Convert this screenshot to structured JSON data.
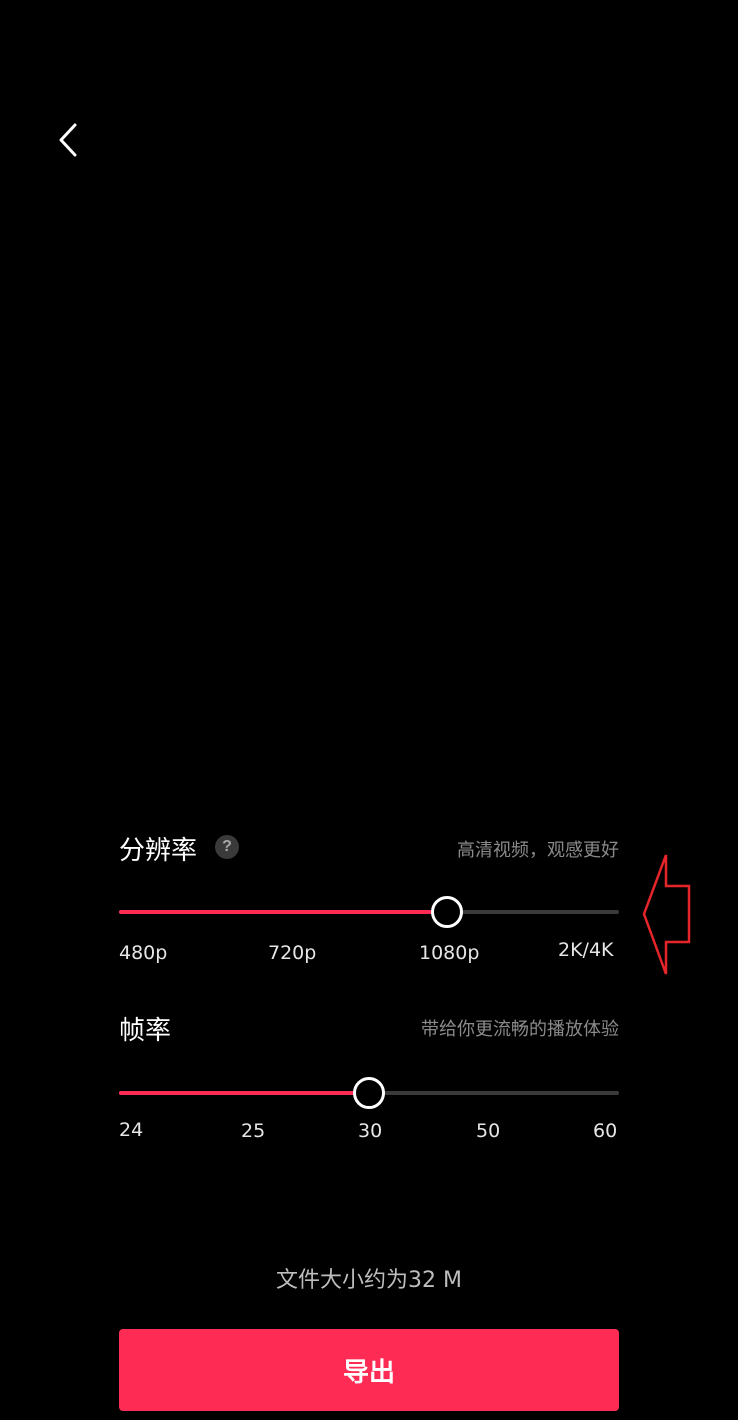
{
  "back": {
    "icon": "chevron-left-icon"
  },
  "resolution": {
    "title": "分辨率",
    "help_icon": "question-icon",
    "help_glyph": "?",
    "hint": "高清视频，观感更好",
    "options": [
      "480p",
      "720p",
      "1080p",
      "2K/4K"
    ],
    "selected": "1080p",
    "selected_index": 2
  },
  "framerate": {
    "title": "帧率",
    "hint": "带给你更流畅的播放体验",
    "options": [
      "24",
      "25",
      "30",
      "50",
      "60"
    ],
    "selected": "30",
    "selected_index": 2
  },
  "file_size": "文件大小约为32 M",
  "export_label": "导出",
  "colors": {
    "accent": "#fe2c55",
    "track": "#3a3a3a",
    "background": "#000000",
    "annotation": "#e5252a"
  },
  "annotation": {
    "icon": "left-arrow-outline-icon"
  }
}
